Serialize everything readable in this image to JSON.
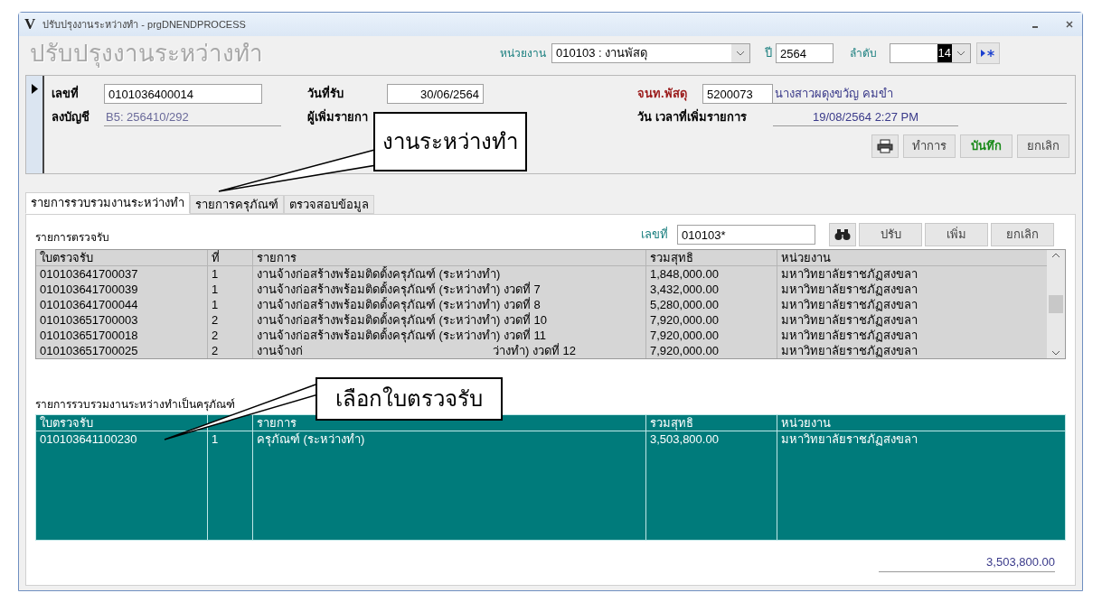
{
  "window": {
    "logo": "V",
    "title": "ปรับปรุงงานระหว่างทำ - prgDNENDPROCESS"
  },
  "heading": "ปรับปรุงงานระหว่างทำ",
  "unit": {
    "label": "หน่วยงาน",
    "value": "010103 : งานพัสดุ"
  },
  "year": {
    "label": "ปี",
    "value": "2564"
  },
  "order": {
    "label": "ลำดับ",
    "value": "14"
  },
  "header": {
    "doc_no": {
      "label": "เลขที่",
      "value": "0101036400014"
    },
    "received_date": {
      "label": "วันที่รับ",
      "value": "30/06/2564"
    },
    "officer": {
      "label": "จนท.พัสดุ",
      "value": "5200073",
      "name": "นางสาวผดุงขวัญ  คมขำ"
    },
    "account": {
      "label": "ลงบัญชี",
      "value": "B5: 256410/292"
    },
    "added_by": {
      "label": "ผู้เพิ่มรายกา"
    },
    "added_at": {
      "label": "วัน เวลาที่เพิ่มรายการ",
      "value": "19/08/2564  2:27 PM"
    },
    "buttons": [
      {
        "kind": "print"
      },
      {
        "kind": "text",
        "label": "ทำการ",
        "emphasis": false
      },
      {
        "kind": "text",
        "label": "บันทึก",
        "emphasis": true
      },
      {
        "kind": "text",
        "label": "ยกเลิก",
        "emphasis": false
      }
    ]
  },
  "tabs": [
    {
      "label": "รายการรวบรวมงานระหว่างทำ",
      "selected": true
    },
    {
      "label": "รายการครุภัณฑ์",
      "selected": false
    },
    {
      "label": "ตรวจสอบข้อมูล",
      "selected": false
    }
  ],
  "inspections": {
    "title": "รายการตรวจรับ",
    "search": {
      "label": "เลขที่",
      "value": "010103*"
    },
    "buttons": [
      {
        "kind": "find"
      },
      {
        "kind": "text",
        "label": "ปรับ"
      },
      {
        "kind": "text",
        "label": "เพิ่ม"
      },
      {
        "kind": "text",
        "label": "ยกเลิก"
      }
    ],
    "columns": [
      "ใบตรวจรับ",
      "ที่",
      "รายการ",
      "รวมสุทธิ",
      "หน่วยงาน"
    ],
    "rows": [
      {
        "cells": [
          "010103641700037",
          "1",
          "งานจ้างก่อสร้างพร้อมติดตั้งครุภัณฑ์ (ระหว่างทำ)",
          "1,848,000.00",
          "มหาวิทยาลัยราชภัฏสงขลา"
        ]
      },
      {
        "cells": [
          "010103641700039",
          "1",
          "งานจ้างก่อสร้างพร้อมติดตั้งครุภัณฑ์ (ระหว่างทำ) งวดที่ 7",
          "3,432,000.00",
          "มหาวิทยาลัยราชภัฏสงขลา"
        ]
      },
      {
        "cells": [
          "010103641700044",
          "1",
          "งานจ้างก่อสร้างพร้อมติดตั้งครุภัณฑ์ (ระหว่างทำ) งวดที่ 8",
          "5,280,000.00",
          "มหาวิทยาลัยราชภัฏสงขลา"
        ]
      },
      {
        "cells": [
          "010103651700003",
          "2",
          "งานจ้างก่อสร้างพร้อมติดตั้งครุภัณฑ์ (ระหว่างทำ) งวดที่ 10",
          "7,920,000.00",
          "มหาวิทยาลัยราชภัฏสงขลา"
        ]
      },
      {
        "cells": [
          "010103651700018",
          "2",
          "งานจ้างก่อสร้างพร้อมติดตั้งครุภัณฑ์ (ระหว่างทำ) งวดที่ 11",
          "7,920,000.00",
          "มหาวิทยาลัยราชภัฏสงขลา"
        ]
      },
      {
        "cells": [
          "010103651700025",
          "2",
          [
            "งานจ้างก่",
            "ว่างทำ) งวดที่ 12"
          ],
          "7,920,000.00",
          "มหาวิทยาลัยราชภัฏสงขลา"
        ]
      }
    ]
  },
  "collected": {
    "title": "รายการรวบรวมงานระหว่างทำเป็นครุภัณฑ์",
    "columns": [
      "ใบตรวจรับ",
      "",
      "รายการ",
      "รวมสุทธิ",
      "หน่วยงาน"
    ],
    "rows": [
      {
        "cells": [
          "010103641100230",
          "1",
          "ครุภัณฑ์ (ระหว่างทำ)",
          "3,503,800.00",
          "มหาวิทยาลัยราชภัฏสงขลา"
        ]
      }
    ],
    "total": "3,503,800.00"
  },
  "callouts": [
    {
      "text": "งานระหว่างทำ"
    },
    {
      "text": "เลือกใบตรวจรับ"
    }
  ]
}
